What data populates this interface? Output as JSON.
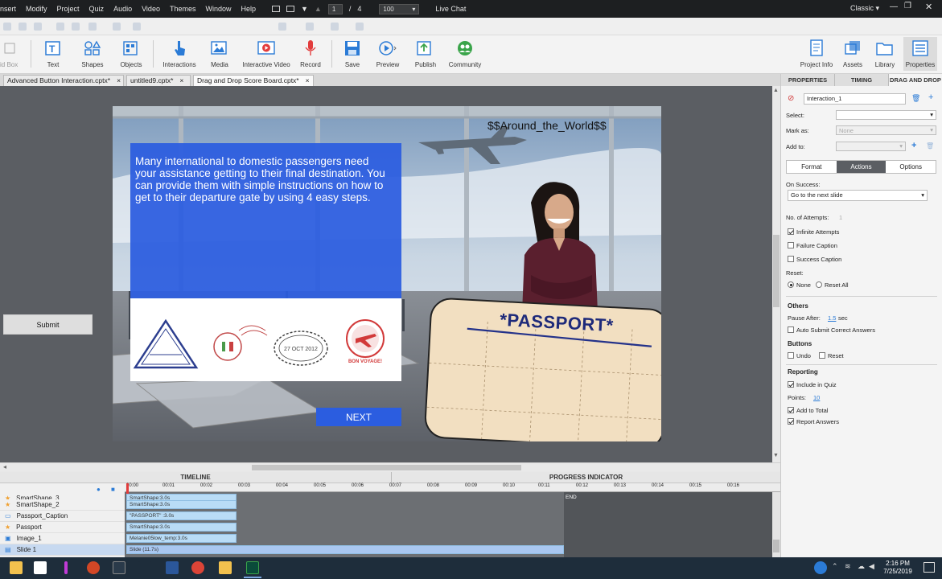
{
  "menu": {
    "items": [
      "nsert",
      "Modify",
      "Project",
      "Quiz",
      "Audio",
      "Video",
      "Themes",
      "Window",
      "Help"
    ],
    "page_current": "1",
    "page_sep": "/",
    "page_total": "4",
    "zoom": "100",
    "live_chat": "Live Chat",
    "workspace": "Classic"
  },
  "toolbar": {
    "cut_label": "id Box",
    "text": "Text",
    "shapes": "Shapes",
    "objects": "Objects",
    "interactions": "Interactions",
    "media": "Media",
    "interactive_video": "Interactive Video",
    "record": "Record",
    "save": "Save",
    "preview": "Preview",
    "publish": "Publish",
    "community": "Community",
    "project_info": "Project Info",
    "assets": "Assets",
    "library": "Library",
    "properties": "Properties"
  },
  "tabs": [
    {
      "label": "Advanced Button Interaction.cptx*"
    },
    {
      "label": "untitled9.cptx*"
    },
    {
      "label": "Drag and Drop Score Board.cptx*"
    }
  ],
  "tab_close": "×",
  "slide": {
    "title": "$$Around_the_World$$",
    "intro_text": "Many international to domestic passengers need your assistance getting to their final destination. You can provide them with simple instructions on how to get to their departure gate by using 4 easy steps.",
    "next_button": "NEXT",
    "passport_label": "*PASSPORT*",
    "stamp_date": "27 OCT 2012",
    "stamp_bon": "BON VOYAGE!"
  },
  "submit_button": "Submit",
  "timeline": {
    "tab_timeline": "TIMELINE",
    "tab_progress": "PROGRESS INDICATOR",
    "ticks": [
      "00:00",
      "00:01",
      "00:02",
      "00:03",
      "00:04",
      "00:05",
      "00:06",
      "00:07",
      "00:08",
      "00:09",
      "00:10",
      "00:11",
      "00:12",
      "00:13",
      "00:14",
      "00:15",
      "00:16"
    ],
    "end_label": "END",
    "rows": [
      {
        "name": "SmartShape_3",
        "bar": "SmartShape:3.0s"
      },
      {
        "name": "SmartShape_2",
        "bar": "SmartShape:3.0s"
      },
      {
        "name": "Passport_Caption",
        "bar": "\"PASSPORT\" :3.0s"
      },
      {
        "name": "Passport",
        "bar": "SmartShape:3.0s"
      },
      {
        "name": "Image_1",
        "bar": "Melanie05low_temp:3.0s"
      },
      {
        "name": "Slide 1",
        "bar": "Slide (11.7s)"
      }
    ]
  },
  "properties": {
    "tabs": [
      "PROPERTIES",
      "TIMING",
      "DRAG AND DROP"
    ],
    "name_value": "Interaction_1",
    "select_label": "Select:",
    "mark_as_label": "Mark as:",
    "mark_as_value": "None",
    "add_to_label": "Add to:",
    "subtabs": [
      "Format",
      "Actions",
      "Options"
    ],
    "on_success_label": "On Success:",
    "on_success_value": "Go to the next slide",
    "attempts_label": "No. of Attempts:",
    "attempts_value": "1",
    "infinite_attempts": "Infinite Attempts",
    "failure_caption": "Failure Caption",
    "success_caption": "Success Caption",
    "reset_label": "Reset:",
    "reset_none": "None",
    "reset_all": "Reset All",
    "others_header": "Others",
    "pause_after_label": "Pause After:",
    "pause_after_value": "1.5",
    "pause_after_unit": "sec",
    "auto_submit": "Auto Submit Correct Answers",
    "buttons_header": "Buttons",
    "undo": "Undo",
    "reset": "Reset",
    "reporting_header": "Reporting",
    "include_in_quiz": "Include in Quiz",
    "points_label": "Points:",
    "points_value": "10",
    "add_to_total": "Add to Total",
    "report_answers": "Report Answers"
  },
  "taskbar": {
    "time": "2:16 PM",
    "date": "7/25/2019"
  }
}
